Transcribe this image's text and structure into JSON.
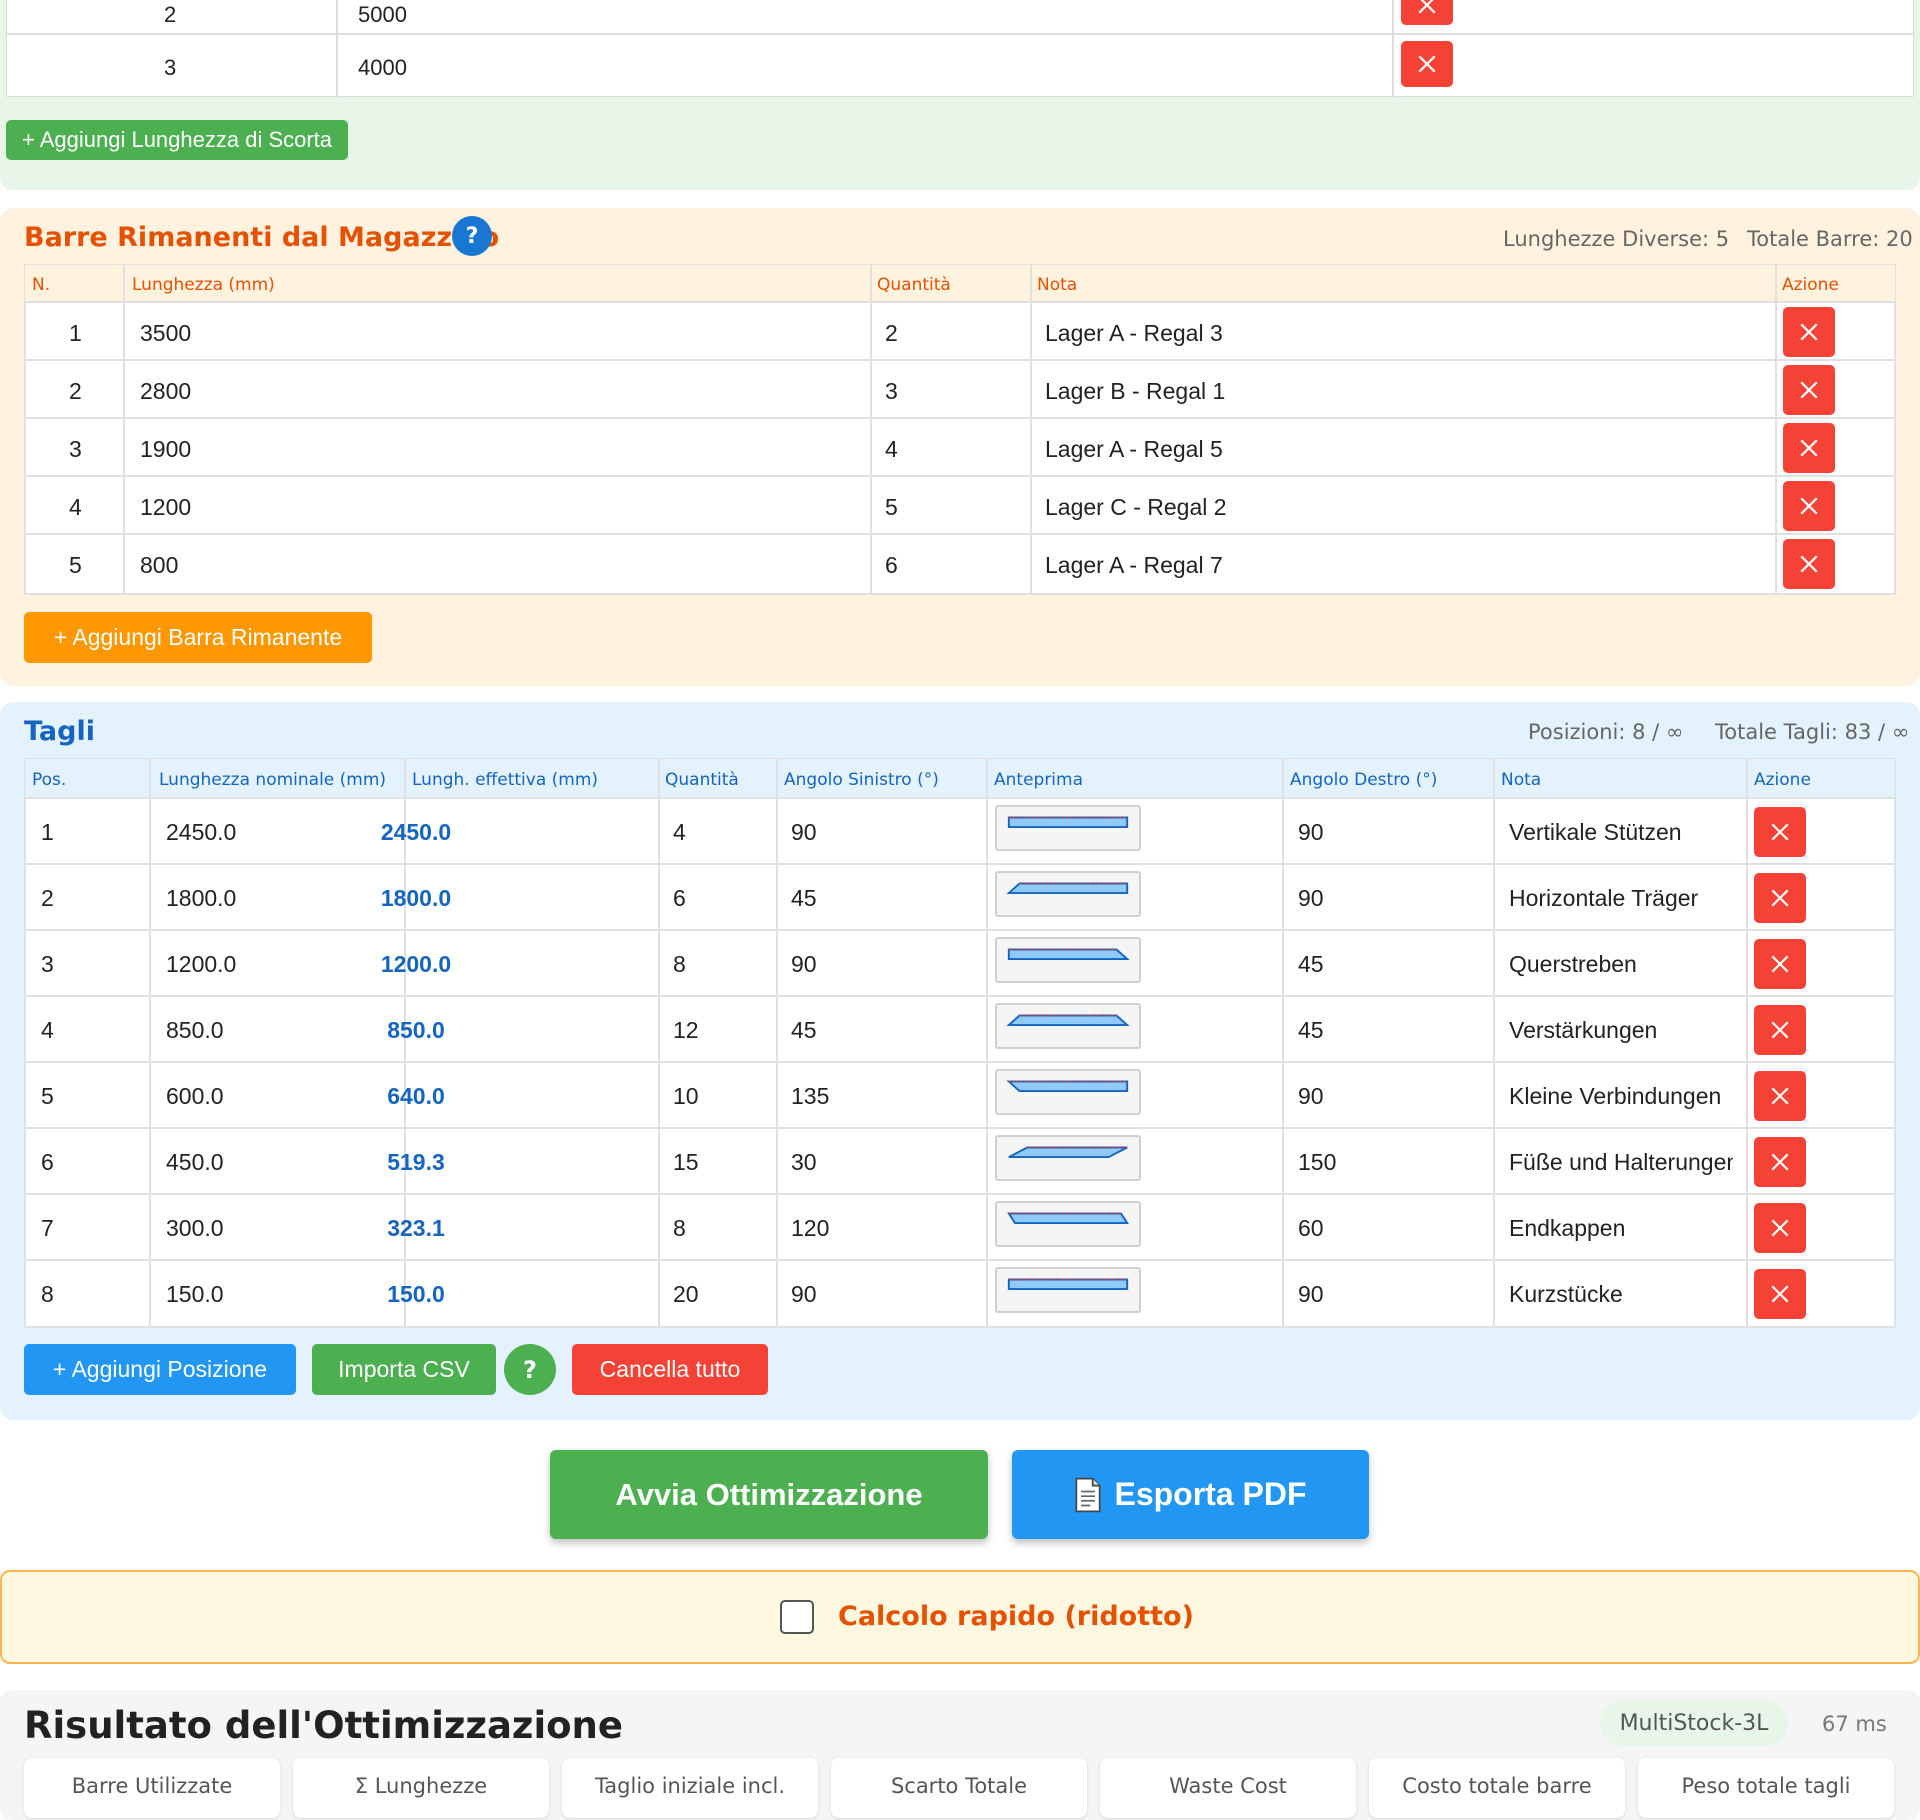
{
  "stock": {
    "rows": [
      {
        "n": "2",
        "length": "5000"
      },
      {
        "n": "3",
        "length": "4000"
      }
    ],
    "add_label": "+ Aggiungi Lunghezza di Scorta"
  },
  "remnants": {
    "title": "Barre Rimanenti dal Magazzino",
    "help": "?",
    "stat_lengths": "Lunghezze Diverse: 5",
    "stat_bars": "Totale Barre: 20",
    "headers": [
      "N.",
      "Lunghezza (mm)",
      "Quantità",
      "Nota",
      "Azione"
    ],
    "rows": [
      {
        "n": "1",
        "length": "3500",
        "qty": "2",
        "note": "Lager A - Regal 3"
      },
      {
        "n": "2",
        "length": "2800",
        "qty": "3",
        "note": "Lager B - Regal 1"
      },
      {
        "n": "3",
        "length": "1900",
        "qty": "4",
        "note": "Lager A - Regal 5"
      },
      {
        "n": "4",
        "length": "1200",
        "qty": "5",
        "note": "Lager C - Regal 2"
      },
      {
        "n": "5",
        "length": "800",
        "qty": "6",
        "note": "Lager A - Regal 7"
      }
    ],
    "add_label": "+ Aggiungi Barra Rimanente"
  },
  "cuts": {
    "title": "Tagli",
    "stat_positions": "Posizioni: 8 / ∞",
    "stat_cuts": "Totale Tagli: 83 / ∞",
    "headers": [
      "Pos.",
      "Lunghezza nominale (mm)",
      "Lungh. effettiva (mm)",
      "Quantità",
      "Angolo Sinistro (°)",
      "Anteprima",
      "Angolo Destro (°)",
      "Nota",
      "Azione"
    ],
    "rows": [
      {
        "pos": "1",
        "nominal": "2450.0",
        "effective": "2450.0",
        "qty": "4",
        "left": "90",
        "right": "90",
        "note": "Vertikale Stützen"
      },
      {
        "pos": "2",
        "nominal": "1800.0",
        "effective": "1800.0",
        "qty": "6",
        "left": "45",
        "right": "90",
        "note": "Horizontale Träger"
      },
      {
        "pos": "3",
        "nominal": "1200.0",
        "effective": "1200.0",
        "qty": "8",
        "left": "90",
        "right": "45",
        "note": "Querstreben"
      },
      {
        "pos": "4",
        "nominal": "850.0",
        "effective": "850.0",
        "qty": "12",
        "left": "45",
        "right": "45",
        "note": "Verstärkungen"
      },
      {
        "pos": "5",
        "nominal": "600.0",
        "effective": "640.0",
        "qty": "10",
        "left": "135",
        "right": "90",
        "note": "Kleine Verbindungen"
      },
      {
        "pos": "6",
        "nominal": "450.0",
        "effective": "519.3",
        "qty": "15",
        "left": "30",
        "right": "150",
        "note": "Füße und Halterungen"
      },
      {
        "pos": "7",
        "nominal": "300.0",
        "effective": "323.1",
        "qty": "8",
        "left": "120",
        "right": "60",
        "note": "Endkappen"
      },
      {
        "pos": "8",
        "nominal": "150.0",
        "effective": "150.0",
        "qty": "20",
        "left": "90",
        "right": "90",
        "note": "Kurzstücke"
      }
    ],
    "add_label": "+ Aggiungi Posizione",
    "import_label": "Importa CSV",
    "help": "?",
    "clear_label": "Cancella tutto"
  },
  "actions": {
    "optimize_label": "Avvia Ottimizzazione",
    "export_label": "Esporta PDF",
    "export_icon": "document-icon"
  },
  "quick": {
    "label": "Calcolo rapido (ridotto)",
    "checked": false
  },
  "results": {
    "title": "Risultato dell'Ottimizzazione",
    "algorithm": "MultiStock-3L",
    "time": "67 ms",
    "cards": [
      "Barre Utilizzate",
      "Σ Lunghezze",
      "Taglio iniziale incl.",
      "Scarto Totale",
      "Waste Cost",
      "Costo totale barre",
      "Peso totale tagli"
    ]
  },
  "colors": {
    "green": "#4caf50",
    "orange": "#ff9800",
    "blue": "#2196f3",
    "red": "#f44336",
    "remnant_title": "#e65100",
    "cuts_title": "#1565c0"
  }
}
